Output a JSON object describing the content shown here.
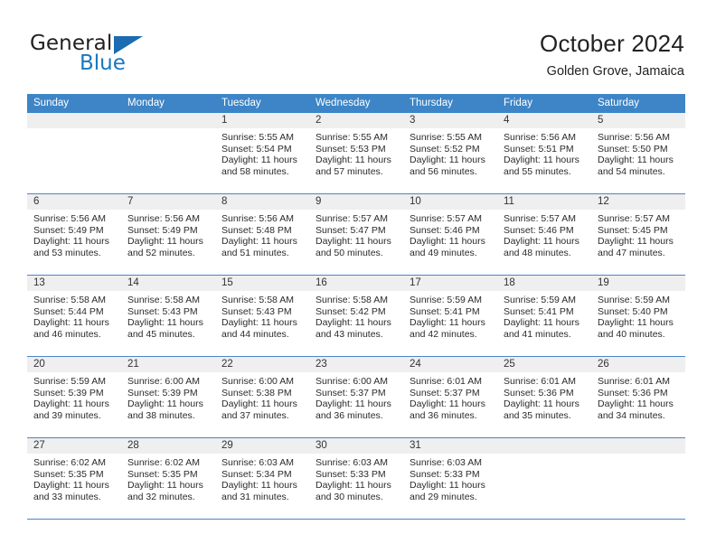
{
  "brand": {
    "name_part1": "General",
    "name_part2": "Blue",
    "logo_icon": "triangle-flag-icon",
    "accent_color": "#1878be"
  },
  "header": {
    "title": "October 2024",
    "subtitle": "Golden Grove, Jamaica"
  },
  "colors": {
    "header_row_bg": "#3d85c6",
    "day_band_bg": "#efefef",
    "grid_line": "#4a86c8",
    "text": "#2b2b2b"
  },
  "weekday_headers": [
    "Sunday",
    "Monday",
    "Tuesday",
    "Wednesday",
    "Thursday",
    "Friday",
    "Saturday"
  ],
  "weeks": [
    [
      {
        "day": "",
        "empty": true,
        "sunrise": "",
        "sunset": "",
        "daylight1": "",
        "daylight2": ""
      },
      {
        "day": "",
        "empty": true,
        "sunrise": "",
        "sunset": "",
        "daylight1": "",
        "daylight2": ""
      },
      {
        "day": "1",
        "sunrise": "Sunrise: 5:55 AM",
        "sunset": "Sunset: 5:54 PM",
        "daylight1": "Daylight: 11 hours",
        "daylight2": "and 58 minutes."
      },
      {
        "day": "2",
        "sunrise": "Sunrise: 5:55 AM",
        "sunset": "Sunset: 5:53 PM",
        "daylight1": "Daylight: 11 hours",
        "daylight2": "and 57 minutes."
      },
      {
        "day": "3",
        "sunrise": "Sunrise: 5:55 AM",
        "sunset": "Sunset: 5:52 PM",
        "daylight1": "Daylight: 11 hours",
        "daylight2": "and 56 minutes."
      },
      {
        "day": "4",
        "sunrise": "Sunrise: 5:56 AM",
        "sunset": "Sunset: 5:51 PM",
        "daylight1": "Daylight: 11 hours",
        "daylight2": "and 55 minutes."
      },
      {
        "day": "5",
        "sunrise": "Sunrise: 5:56 AM",
        "sunset": "Sunset: 5:50 PM",
        "daylight1": "Daylight: 11 hours",
        "daylight2": "and 54 minutes."
      }
    ],
    [
      {
        "day": "6",
        "sunrise": "Sunrise: 5:56 AM",
        "sunset": "Sunset: 5:49 PM",
        "daylight1": "Daylight: 11 hours",
        "daylight2": "and 53 minutes."
      },
      {
        "day": "7",
        "sunrise": "Sunrise: 5:56 AM",
        "sunset": "Sunset: 5:49 PM",
        "daylight1": "Daylight: 11 hours",
        "daylight2": "and 52 minutes."
      },
      {
        "day": "8",
        "sunrise": "Sunrise: 5:56 AM",
        "sunset": "Sunset: 5:48 PM",
        "daylight1": "Daylight: 11 hours",
        "daylight2": "and 51 minutes."
      },
      {
        "day": "9",
        "sunrise": "Sunrise: 5:57 AM",
        "sunset": "Sunset: 5:47 PM",
        "daylight1": "Daylight: 11 hours",
        "daylight2": "and 50 minutes."
      },
      {
        "day": "10",
        "sunrise": "Sunrise: 5:57 AM",
        "sunset": "Sunset: 5:46 PM",
        "daylight1": "Daylight: 11 hours",
        "daylight2": "and 49 minutes."
      },
      {
        "day": "11",
        "sunrise": "Sunrise: 5:57 AM",
        "sunset": "Sunset: 5:46 PM",
        "daylight1": "Daylight: 11 hours",
        "daylight2": "and 48 minutes."
      },
      {
        "day": "12",
        "sunrise": "Sunrise: 5:57 AM",
        "sunset": "Sunset: 5:45 PM",
        "daylight1": "Daylight: 11 hours",
        "daylight2": "and 47 minutes."
      }
    ],
    [
      {
        "day": "13",
        "sunrise": "Sunrise: 5:58 AM",
        "sunset": "Sunset: 5:44 PM",
        "daylight1": "Daylight: 11 hours",
        "daylight2": "and 46 minutes."
      },
      {
        "day": "14",
        "sunrise": "Sunrise: 5:58 AM",
        "sunset": "Sunset: 5:43 PM",
        "daylight1": "Daylight: 11 hours",
        "daylight2": "and 45 minutes."
      },
      {
        "day": "15",
        "sunrise": "Sunrise: 5:58 AM",
        "sunset": "Sunset: 5:43 PM",
        "daylight1": "Daylight: 11 hours",
        "daylight2": "and 44 minutes."
      },
      {
        "day": "16",
        "sunrise": "Sunrise: 5:58 AM",
        "sunset": "Sunset: 5:42 PM",
        "daylight1": "Daylight: 11 hours",
        "daylight2": "and 43 minutes."
      },
      {
        "day": "17",
        "sunrise": "Sunrise: 5:59 AM",
        "sunset": "Sunset: 5:41 PM",
        "daylight1": "Daylight: 11 hours",
        "daylight2": "and 42 minutes."
      },
      {
        "day": "18",
        "sunrise": "Sunrise: 5:59 AM",
        "sunset": "Sunset: 5:41 PM",
        "daylight1": "Daylight: 11 hours",
        "daylight2": "and 41 minutes."
      },
      {
        "day": "19",
        "sunrise": "Sunrise: 5:59 AM",
        "sunset": "Sunset: 5:40 PM",
        "daylight1": "Daylight: 11 hours",
        "daylight2": "and 40 minutes."
      }
    ],
    [
      {
        "day": "20",
        "sunrise": "Sunrise: 5:59 AM",
        "sunset": "Sunset: 5:39 PM",
        "daylight1": "Daylight: 11 hours",
        "daylight2": "and 39 minutes."
      },
      {
        "day": "21",
        "sunrise": "Sunrise: 6:00 AM",
        "sunset": "Sunset: 5:39 PM",
        "daylight1": "Daylight: 11 hours",
        "daylight2": "and 38 minutes."
      },
      {
        "day": "22",
        "sunrise": "Sunrise: 6:00 AM",
        "sunset": "Sunset: 5:38 PM",
        "daylight1": "Daylight: 11 hours",
        "daylight2": "and 37 minutes."
      },
      {
        "day": "23",
        "sunrise": "Sunrise: 6:00 AM",
        "sunset": "Sunset: 5:37 PM",
        "daylight1": "Daylight: 11 hours",
        "daylight2": "and 36 minutes."
      },
      {
        "day": "24",
        "sunrise": "Sunrise: 6:01 AM",
        "sunset": "Sunset: 5:37 PM",
        "daylight1": "Daylight: 11 hours",
        "daylight2": "and 36 minutes."
      },
      {
        "day": "25",
        "sunrise": "Sunrise: 6:01 AM",
        "sunset": "Sunset: 5:36 PM",
        "daylight1": "Daylight: 11 hours",
        "daylight2": "and 35 minutes."
      },
      {
        "day": "26",
        "sunrise": "Sunrise: 6:01 AM",
        "sunset": "Sunset: 5:36 PM",
        "daylight1": "Daylight: 11 hours",
        "daylight2": "and 34 minutes."
      }
    ],
    [
      {
        "day": "27",
        "sunrise": "Sunrise: 6:02 AM",
        "sunset": "Sunset: 5:35 PM",
        "daylight1": "Daylight: 11 hours",
        "daylight2": "and 33 minutes."
      },
      {
        "day": "28",
        "sunrise": "Sunrise: 6:02 AM",
        "sunset": "Sunset: 5:35 PM",
        "daylight1": "Daylight: 11 hours",
        "daylight2": "and 32 minutes."
      },
      {
        "day": "29",
        "sunrise": "Sunrise: 6:03 AM",
        "sunset": "Sunset: 5:34 PM",
        "daylight1": "Daylight: 11 hours",
        "daylight2": "and 31 minutes."
      },
      {
        "day": "30",
        "sunrise": "Sunrise: 6:03 AM",
        "sunset": "Sunset: 5:33 PM",
        "daylight1": "Daylight: 11 hours",
        "daylight2": "and 30 minutes."
      },
      {
        "day": "31",
        "sunrise": "Sunrise: 6:03 AM",
        "sunset": "Sunset: 5:33 PM",
        "daylight1": "Daylight: 11 hours",
        "daylight2": "and 29 minutes."
      },
      {
        "day": "",
        "empty": true,
        "sunrise": "",
        "sunset": "",
        "daylight1": "",
        "daylight2": ""
      },
      {
        "day": "",
        "empty": true,
        "sunrise": "",
        "sunset": "",
        "daylight1": "",
        "daylight2": ""
      }
    ]
  ]
}
